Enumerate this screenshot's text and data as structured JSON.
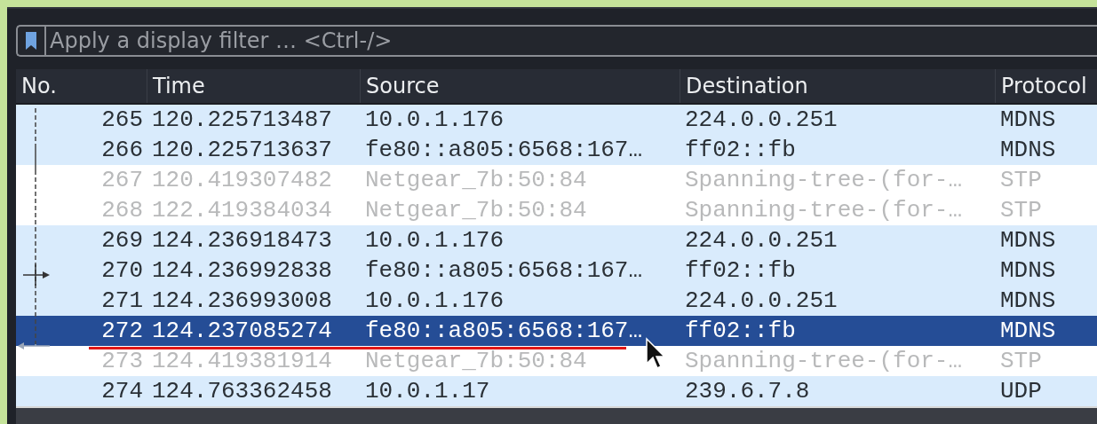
{
  "filter": {
    "placeholder": "Apply a display filter … <Ctrl-/>"
  },
  "columns": [
    "No.",
    "Time",
    "Source",
    "Destination",
    "Protocol"
  ],
  "rows": [
    {
      "no": "265",
      "time": "120.225713487",
      "source": "10.0.1.176",
      "destination": "224.0.0.251",
      "protocol": "MDNS",
      "dimmed": false,
      "selected": false
    },
    {
      "no": "266",
      "time": "120.225713637",
      "source": "fe80::a805:6568:167…",
      "destination": "ff02::fb",
      "protocol": "MDNS",
      "dimmed": false,
      "selected": false
    },
    {
      "no": "267",
      "time": "120.419307482",
      "source": "Netgear_7b:50:84",
      "destination": "Spanning-tree-(for-…",
      "protocol": "STP",
      "dimmed": true,
      "selected": false
    },
    {
      "no": "268",
      "time": "122.419384034",
      "source": "Netgear_7b:50:84",
      "destination": "Spanning-tree-(for-…",
      "protocol": "STP",
      "dimmed": true,
      "selected": false
    },
    {
      "no": "269",
      "time": "124.236918473",
      "source": "10.0.1.176",
      "destination": "224.0.0.251",
      "protocol": "MDNS",
      "dimmed": false,
      "selected": false
    },
    {
      "no": "270",
      "time": "124.236992838",
      "source": "fe80::a805:6568:167…",
      "destination": "ff02::fb",
      "protocol": "MDNS",
      "dimmed": false,
      "selected": false
    },
    {
      "no": "271",
      "time": "124.236993008",
      "source": "10.0.1.176",
      "destination": "224.0.0.251",
      "protocol": "MDNS",
      "dimmed": false,
      "selected": false
    },
    {
      "no": "272",
      "time": "124.237085274",
      "source": "fe80::a805:6568:167…",
      "destination": "ff02::fb",
      "protocol": "MDNS",
      "dimmed": false,
      "selected": true
    },
    {
      "no": "273",
      "time": "124.419381914",
      "source": "Netgear_7b:50:84",
      "destination": "Spanning-tree-(for-…",
      "protocol": "STP",
      "dimmed": true,
      "selected": false
    },
    {
      "no": "274",
      "time": "124.763362458",
      "source": "10.0.1.17",
      "destination": "239.6.7.8",
      "protocol": "UDP",
      "dimmed": false,
      "selected": false
    }
  ]
}
